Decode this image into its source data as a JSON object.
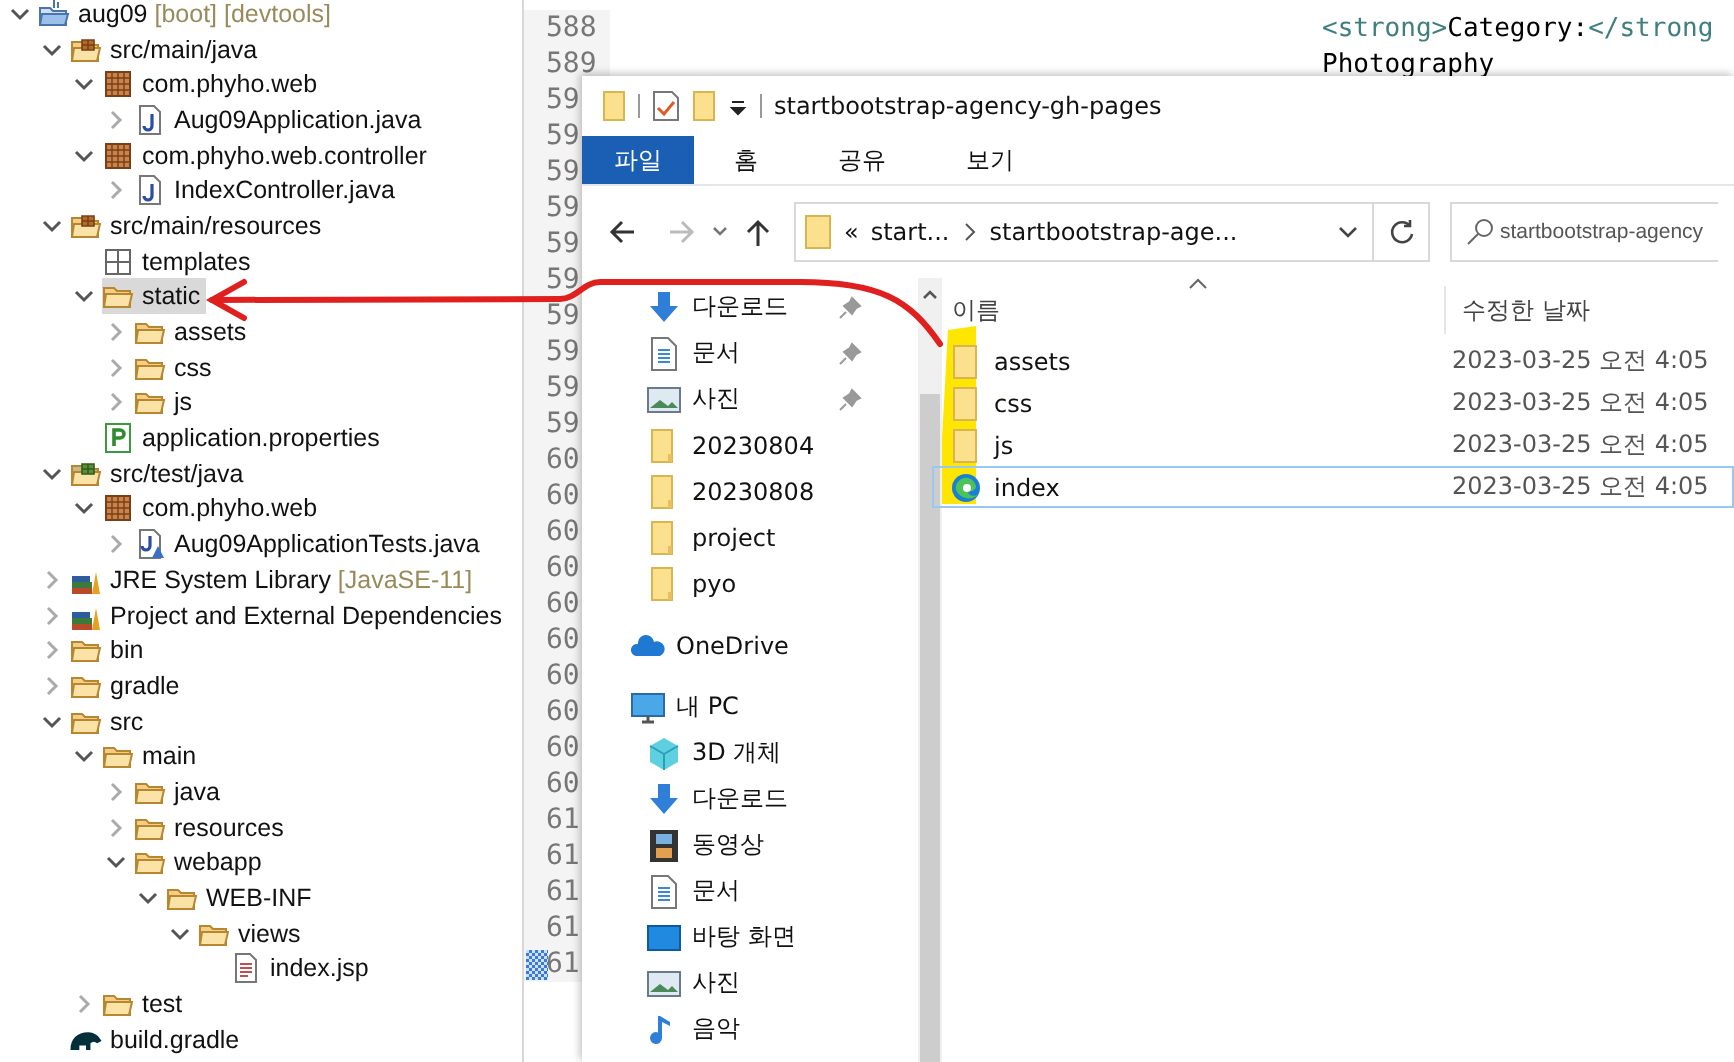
{
  "tree": [
    {
      "label": "aug09",
      "suffix": "[boot] [devtools]",
      "kind": "project",
      "expanded": true,
      "selected": false,
      "children": [
        {
          "label": "src/main/java",
          "kind": "source-folder",
          "expanded": true,
          "selected": false,
          "children": [
            {
              "label": "com.phyho.web",
              "kind": "package",
              "expanded": true,
              "selected": false,
              "children": [
                {
                  "label": "Aug09Application.java",
                  "kind": "java",
                  "expanded": false,
                  "selected": false
                }
              ]
            },
            {
              "label": "com.phyho.web.controller",
              "kind": "package",
              "expanded": true,
              "selected": false,
              "children": [
                {
                  "label": "IndexController.java",
                  "kind": "java",
                  "expanded": false,
                  "selected": false
                }
              ]
            }
          ]
        },
        {
          "label": "src/main/resources",
          "kind": "source-folder",
          "expanded": true,
          "selected": false,
          "children": [
            {
              "label": "templates",
              "kind": "empty-package",
              "selected": false
            },
            {
              "label": "static",
              "kind": "folder",
              "expanded": true,
              "selected": true,
              "children": [
                {
                  "label": "assets",
                  "kind": "folder",
                  "expanded": false,
                  "selected": false
                },
                {
                  "label": "css",
                  "kind": "folder",
                  "expanded": false,
                  "selected": false
                },
                {
                  "label": "js",
                  "kind": "folder",
                  "expanded": false,
                  "selected": false
                }
              ]
            },
            {
              "label": "application.properties",
              "kind": "properties",
              "selected": false
            }
          ]
        },
        {
          "label": "src/test/java",
          "kind": "test-folder",
          "expanded": true,
          "selected": false,
          "children": [
            {
              "label": "com.phyho.web",
              "kind": "package",
              "expanded": true,
              "selected": false,
              "children": [
                {
                  "label": "Aug09ApplicationTests.java",
                  "kind": "test-java",
                  "expanded": false,
                  "selected": false
                }
              ]
            }
          ]
        },
        {
          "label": "JRE System Library",
          "suffix": "[JavaSE-11]",
          "kind": "library",
          "expanded": false,
          "selected": false
        },
        {
          "label": "Project and External Dependencies",
          "kind": "library",
          "expanded": false,
          "selected": false
        },
        {
          "label": "bin",
          "kind": "folder",
          "expanded": false,
          "selected": false
        },
        {
          "label": "gradle",
          "kind": "folder",
          "expanded": false,
          "selected": false
        },
        {
          "label": "src",
          "kind": "folder",
          "expanded": true,
          "selected": false,
          "children": [
            {
              "label": "main",
              "kind": "folder",
              "expanded": true,
              "selected": false,
              "children": [
                {
                  "label": "java",
                  "kind": "folder",
                  "expanded": false,
                  "selected": false
                },
                {
                  "label": "resources",
                  "kind": "folder",
                  "expanded": false,
                  "selected": false
                },
                {
                  "label": "webapp",
                  "kind": "folder",
                  "expanded": true,
                  "selected": false,
                  "children": [
                    {
                      "label": "WEB-INF",
                      "kind": "folder",
                      "expanded": true,
                      "selected": false,
                      "children": [
                        {
                          "label": "views",
                          "kind": "folder",
                          "expanded": true,
                          "selected": false,
                          "children": [
                            {
                              "label": "index.jsp",
                              "kind": "jsp",
                              "selected": false
                            }
                          ]
                        }
                      ]
                    }
                  ]
                }
              ]
            },
            {
              "label": "test",
              "kind": "folder",
              "expanded": false,
              "selected": false
            }
          ]
        },
        {
          "label": "build.gradle",
          "kind": "gradle",
          "selected": false
        }
      ]
    }
  ],
  "editor": {
    "lines": [
      {
        "number": "588",
        "marked": false,
        "code": [
          {
            "kind": "tag",
            "text": "<strong>"
          },
          {
            "kind": "text",
            "text": "Category:"
          },
          {
            "kind": "tag",
            "text": "</strong"
          }
        ]
      },
      {
        "number": "589",
        "marked": false,
        "code": [
          {
            "kind": "text",
            "text": "Photography"
          }
        ]
      },
      {
        "number": "59",
        "marked": false
      },
      {
        "number": "59",
        "marked": false
      },
      {
        "number": "59",
        "marked": false
      },
      {
        "number": "59",
        "marked": false
      },
      {
        "number": "59",
        "marked": false
      },
      {
        "number": "59",
        "marked": false
      },
      {
        "number": "59",
        "marked": false
      },
      {
        "number": "59",
        "marked": false
      },
      {
        "number": "59",
        "marked": false
      },
      {
        "number": "59",
        "marked": false
      },
      {
        "number": "60",
        "marked": false
      },
      {
        "number": "60",
        "marked": false
      },
      {
        "number": "60",
        "marked": false
      },
      {
        "number": "60",
        "marked": false
      },
      {
        "number": "60",
        "marked": false
      },
      {
        "number": "60",
        "marked": false
      },
      {
        "number": "60",
        "marked": false
      },
      {
        "number": "60",
        "marked": false
      },
      {
        "number": "60",
        "marked": false
      },
      {
        "number": "60",
        "marked": false
      },
      {
        "number": "61",
        "marked": false
      },
      {
        "number": "61",
        "marked": false
      },
      {
        "number": "61",
        "marked": false
      },
      {
        "number": "61",
        "marked": false
      },
      {
        "number": "61",
        "marked": true
      }
    ]
  },
  "explorer": {
    "title": "startbootstrap-agency-gh-pages",
    "ribbon_tabs": [
      {
        "label": "파일",
        "selected": true
      },
      {
        "label": "홈",
        "selected": false
      },
      {
        "label": "공유",
        "selected": false
      },
      {
        "label": "보기",
        "selected": false
      }
    ],
    "address": {
      "overflow": "«",
      "crumbs": [
        "start...",
        "startbootstrap-age..."
      ]
    },
    "search": {
      "placeholder": "startbootstrap-agency"
    },
    "nav": [
      {
        "label": "다운로드",
        "kind": "download",
        "pinned": true
      },
      {
        "label": "문서",
        "kind": "document",
        "pinned": true
      },
      {
        "label": "사진",
        "kind": "picture",
        "pinned": true
      },
      {
        "label": "20230804",
        "kind": "folder",
        "pinned": false
      },
      {
        "label": "20230808",
        "kind": "folder",
        "pinned": false
      },
      {
        "label": "project",
        "kind": "folder",
        "pinned": false
      },
      {
        "label": "pyo",
        "kind": "folder",
        "pinned": false
      },
      {
        "label": "OneDrive",
        "kind": "cloud",
        "pinned": false
      },
      {
        "label": "내 PC",
        "kind": "pc",
        "pinned": false
      },
      {
        "label": "3D 개체",
        "kind": "cube",
        "pinned": false
      },
      {
        "label": "다운로드",
        "kind": "download",
        "pinned": false
      },
      {
        "label": "동영상",
        "kind": "film",
        "pinned": false
      },
      {
        "label": "문서",
        "kind": "document",
        "pinned": false
      },
      {
        "label": "바탕 화면",
        "kind": "desktop",
        "pinned": false
      },
      {
        "label": "사진",
        "kind": "picture",
        "pinned": false
      },
      {
        "label": "음악",
        "kind": "music",
        "pinned": false
      }
    ],
    "columns": [
      "이름",
      "수정한 날짜"
    ],
    "files": [
      {
        "name": "assets",
        "kind": "folder",
        "date": "2023-03-25 오전 4:05",
        "selected": false
      },
      {
        "name": "css",
        "kind": "folder",
        "date": "2023-03-25 오전 4:05",
        "selected": false
      },
      {
        "name": "js",
        "kind": "folder",
        "date": "2023-03-25 오전 4:05",
        "selected": false
      },
      {
        "name": "index",
        "kind": "edge",
        "date": "2023-03-25 오전 4:05",
        "selected": true
      }
    ]
  }
}
